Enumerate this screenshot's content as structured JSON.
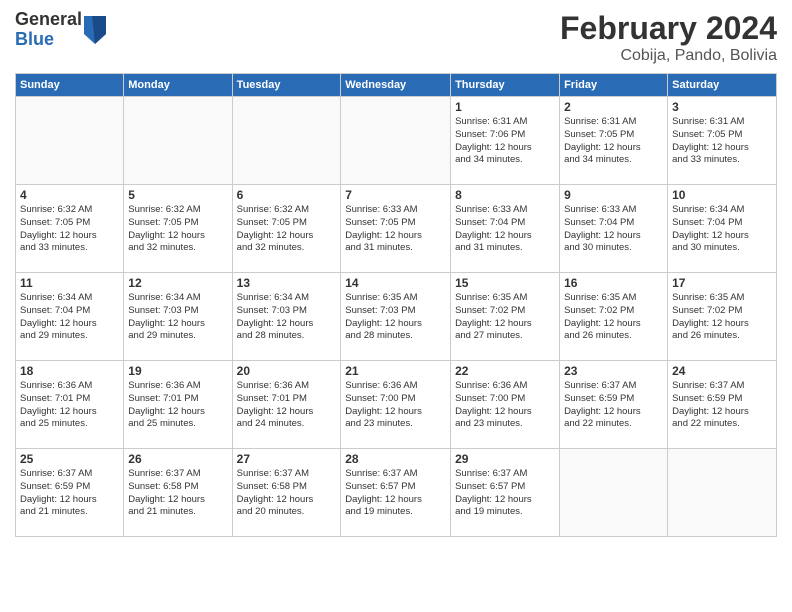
{
  "logo": {
    "general": "General",
    "blue": "Blue"
  },
  "title": {
    "month": "February 2024",
    "location": "Cobija, Pando, Bolivia"
  },
  "headers": [
    "Sunday",
    "Monday",
    "Tuesday",
    "Wednesday",
    "Thursday",
    "Friday",
    "Saturday"
  ],
  "weeks": [
    [
      {
        "day": "",
        "info": ""
      },
      {
        "day": "",
        "info": ""
      },
      {
        "day": "",
        "info": ""
      },
      {
        "day": "",
        "info": ""
      },
      {
        "day": "1",
        "info": "Sunrise: 6:31 AM\nSunset: 7:06 PM\nDaylight: 12 hours\nand 34 minutes."
      },
      {
        "day": "2",
        "info": "Sunrise: 6:31 AM\nSunset: 7:05 PM\nDaylight: 12 hours\nand 34 minutes."
      },
      {
        "day": "3",
        "info": "Sunrise: 6:31 AM\nSunset: 7:05 PM\nDaylight: 12 hours\nand 33 minutes."
      }
    ],
    [
      {
        "day": "4",
        "info": "Sunrise: 6:32 AM\nSunset: 7:05 PM\nDaylight: 12 hours\nand 33 minutes."
      },
      {
        "day": "5",
        "info": "Sunrise: 6:32 AM\nSunset: 7:05 PM\nDaylight: 12 hours\nand 32 minutes."
      },
      {
        "day": "6",
        "info": "Sunrise: 6:32 AM\nSunset: 7:05 PM\nDaylight: 12 hours\nand 32 minutes."
      },
      {
        "day": "7",
        "info": "Sunrise: 6:33 AM\nSunset: 7:05 PM\nDaylight: 12 hours\nand 31 minutes."
      },
      {
        "day": "8",
        "info": "Sunrise: 6:33 AM\nSunset: 7:04 PM\nDaylight: 12 hours\nand 31 minutes."
      },
      {
        "day": "9",
        "info": "Sunrise: 6:33 AM\nSunset: 7:04 PM\nDaylight: 12 hours\nand 30 minutes."
      },
      {
        "day": "10",
        "info": "Sunrise: 6:34 AM\nSunset: 7:04 PM\nDaylight: 12 hours\nand 30 minutes."
      }
    ],
    [
      {
        "day": "11",
        "info": "Sunrise: 6:34 AM\nSunset: 7:04 PM\nDaylight: 12 hours\nand 29 minutes."
      },
      {
        "day": "12",
        "info": "Sunrise: 6:34 AM\nSunset: 7:03 PM\nDaylight: 12 hours\nand 29 minutes."
      },
      {
        "day": "13",
        "info": "Sunrise: 6:34 AM\nSunset: 7:03 PM\nDaylight: 12 hours\nand 28 minutes."
      },
      {
        "day": "14",
        "info": "Sunrise: 6:35 AM\nSunset: 7:03 PM\nDaylight: 12 hours\nand 28 minutes."
      },
      {
        "day": "15",
        "info": "Sunrise: 6:35 AM\nSunset: 7:02 PM\nDaylight: 12 hours\nand 27 minutes."
      },
      {
        "day": "16",
        "info": "Sunrise: 6:35 AM\nSunset: 7:02 PM\nDaylight: 12 hours\nand 26 minutes."
      },
      {
        "day": "17",
        "info": "Sunrise: 6:35 AM\nSunset: 7:02 PM\nDaylight: 12 hours\nand 26 minutes."
      }
    ],
    [
      {
        "day": "18",
        "info": "Sunrise: 6:36 AM\nSunset: 7:01 PM\nDaylight: 12 hours\nand 25 minutes."
      },
      {
        "day": "19",
        "info": "Sunrise: 6:36 AM\nSunset: 7:01 PM\nDaylight: 12 hours\nand 25 minutes."
      },
      {
        "day": "20",
        "info": "Sunrise: 6:36 AM\nSunset: 7:01 PM\nDaylight: 12 hours\nand 24 minutes."
      },
      {
        "day": "21",
        "info": "Sunrise: 6:36 AM\nSunset: 7:00 PM\nDaylight: 12 hours\nand 23 minutes."
      },
      {
        "day": "22",
        "info": "Sunrise: 6:36 AM\nSunset: 7:00 PM\nDaylight: 12 hours\nand 23 minutes."
      },
      {
        "day": "23",
        "info": "Sunrise: 6:37 AM\nSunset: 6:59 PM\nDaylight: 12 hours\nand 22 minutes."
      },
      {
        "day": "24",
        "info": "Sunrise: 6:37 AM\nSunset: 6:59 PM\nDaylight: 12 hours\nand 22 minutes."
      }
    ],
    [
      {
        "day": "25",
        "info": "Sunrise: 6:37 AM\nSunset: 6:59 PM\nDaylight: 12 hours\nand 21 minutes."
      },
      {
        "day": "26",
        "info": "Sunrise: 6:37 AM\nSunset: 6:58 PM\nDaylight: 12 hours\nand 21 minutes."
      },
      {
        "day": "27",
        "info": "Sunrise: 6:37 AM\nSunset: 6:58 PM\nDaylight: 12 hours\nand 20 minutes."
      },
      {
        "day": "28",
        "info": "Sunrise: 6:37 AM\nSunset: 6:57 PM\nDaylight: 12 hours\nand 19 minutes."
      },
      {
        "day": "29",
        "info": "Sunrise: 6:37 AM\nSunset: 6:57 PM\nDaylight: 12 hours\nand 19 minutes."
      },
      {
        "day": "",
        "info": ""
      },
      {
        "day": "",
        "info": ""
      }
    ]
  ]
}
